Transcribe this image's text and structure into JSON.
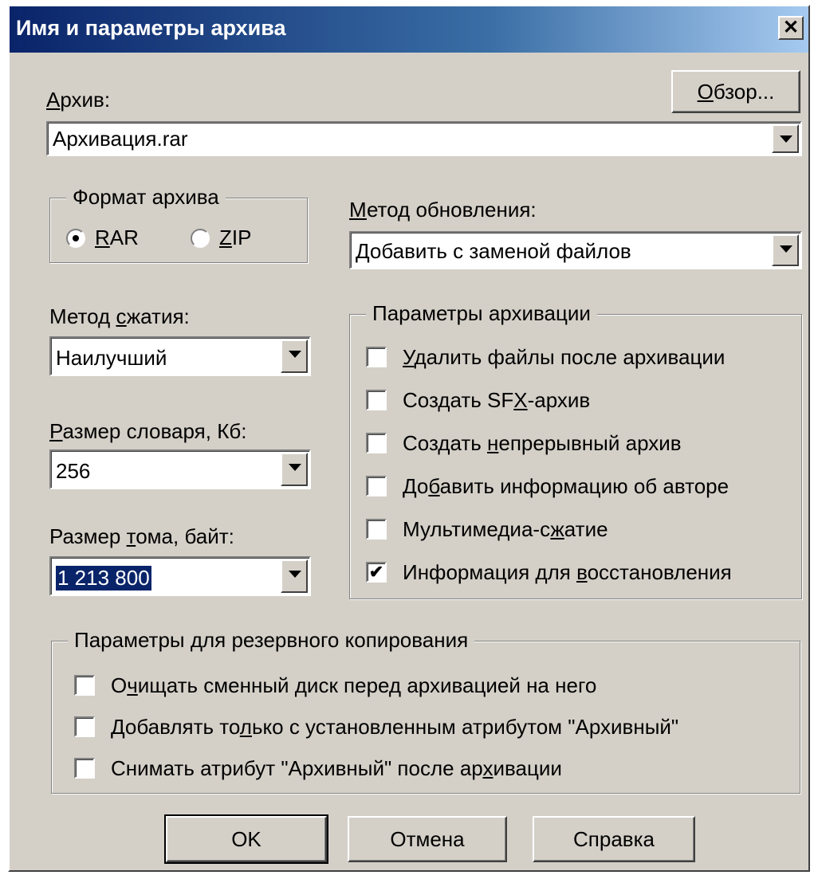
{
  "window": {
    "title": "Имя и параметры архива",
    "close": "✕"
  },
  "archive": {
    "label_u": "А",
    "label_rest": "рхив:",
    "value": "Архивация.rar",
    "browse_u": "О",
    "browse_rest": "бзор..."
  },
  "format": {
    "legend": "Формат архива",
    "options": [
      {
        "u": "R",
        "rest": "AR",
        "selected": true
      },
      {
        "u": "Z",
        "rest": "IP",
        "selected": false
      }
    ]
  },
  "update": {
    "label_u": "М",
    "label_rest": "етод обновления:",
    "value": "Добавить с заменой файлов"
  },
  "compression": {
    "label_pre": "Метод ",
    "label_u": "с",
    "label_rest": "жатия:",
    "value": "Наилучший"
  },
  "dictionary": {
    "label_u": "Р",
    "label_rest": "азмер словаря, Кб:",
    "value": "256"
  },
  "volume": {
    "label_pre": "Размер ",
    "label_u": "т",
    "label_rest": "ома, байт:",
    "value": "1 213 800"
  },
  "options": {
    "legend": "Параметры архивации",
    "items": [
      {
        "pre": "",
        "u": "У",
        "rest": "далить файлы после архивации",
        "checked": false
      },
      {
        "pre": "Создать SF",
        "u": "X",
        "rest": "-архив",
        "checked": false
      },
      {
        "pre": "Создать ",
        "u": "н",
        "rest": "епрерывный архив",
        "checked": false
      },
      {
        "pre": "До",
        "u": "б",
        "rest": "авить информацию об авторе",
        "checked": false
      },
      {
        "pre": "Мультимедиа-с",
        "u": "ж",
        "rest": "атие",
        "checked": false
      },
      {
        "pre": "Информация для ",
        "u": "в",
        "rest": "осстановления",
        "checked": true
      }
    ]
  },
  "backup": {
    "legend": "Параметры для резервного копирования",
    "items": [
      {
        "pre": "О",
        "u": "ч",
        "rest": "ищать сменный диск перед архивацией на него",
        "checked": false
      },
      {
        "pre": "Добавлять то",
        "u": "л",
        "rest": "ько с установленным атрибутом \"Архивный\"",
        "checked": false
      },
      {
        "pre": "Снимать атрибут \"Архивный\" после ар",
        "u": "х",
        "rest": "ивации",
        "checked": false
      }
    ]
  },
  "buttons": {
    "ok": "OK",
    "cancel": "Отмена",
    "help": "Справка"
  },
  "check_mark": "✔"
}
